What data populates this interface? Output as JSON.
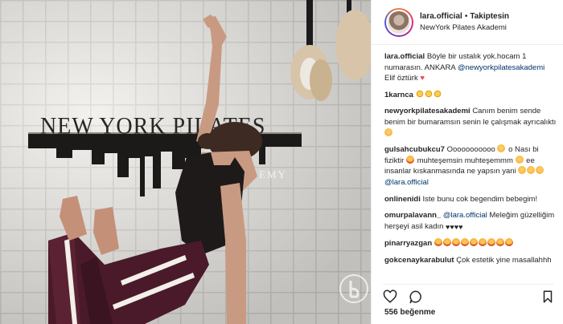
{
  "header": {
    "username": "lara.official",
    "separator": "•",
    "follow_label": "Takiptesin",
    "location": "NewYork Pilates Akademi"
  },
  "photo": {
    "sign_title": "NEW YORK PILATES",
    "sign_subtitle": "EMY"
  },
  "comments": [
    {
      "user": "lara.official",
      "text": "Böyle bir ustalık yok.hocam 1 numarasın. ANKARA",
      "mention": "@newyorkpilatesakademi",
      "tail": "Elif öztürk"
    },
    {
      "user": "1karnca",
      "text": ""
    },
    {
      "user": "newyorkpilatesakademi",
      "text": "Canım benim sende benim bir bumaramsın senin le çalışmak ayrıcalıktı"
    },
    {
      "user": "gulsahcubukcu7",
      "text": "Ooooooooooo",
      "text2": "o Nası bi fiziktir",
      "text3": "muhteşemsin muhteşemmm",
      "text4": "ee insanlar kıskanmasında ne yapsın yani",
      "mention": "@lara.official"
    },
    {
      "user": "onlinenidi",
      "text": "Iste bunu cok begendim bebegim!"
    },
    {
      "user": "omurpalavann_",
      "mention": "@lara.official",
      "text": "Meleğim güzelliğim herşeyi asil kadın"
    },
    {
      "user": "pinarryazgan",
      "text": ""
    },
    {
      "user": "gokcenaykarabulut",
      "text": "Çok estetik yine masallahhh"
    }
  ],
  "footer": {
    "likes": "556 beğenme"
  },
  "icons": {
    "like": "heart-outline",
    "comment": "speech-bubble",
    "save": "bookmark-outline"
  },
  "colors": {
    "mention": "#003569",
    "text": "#262626",
    "border": "#efefef",
    "heart": "#ed4956"
  }
}
